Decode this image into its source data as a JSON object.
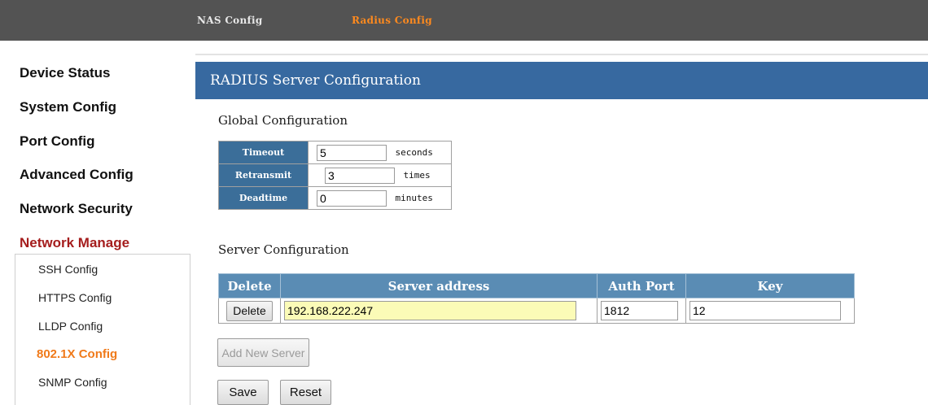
{
  "topbar": {
    "tabs": [
      {
        "label": "NAS Config",
        "active": false
      },
      {
        "label": "Radius Config",
        "active": true
      }
    ],
    "active_color": "#ff8a1e"
  },
  "sidebar": {
    "items": [
      {
        "label": "Device Status"
      },
      {
        "label": "System Config"
      },
      {
        "label": "Port Config"
      },
      {
        "label": "Advanced Config"
      },
      {
        "label": "Network Security"
      },
      {
        "label": "Network Manage",
        "active": true
      }
    ],
    "subitems": [
      {
        "label": "SSH Config"
      },
      {
        "label": "HTTPS Config"
      },
      {
        "label": "LLDP Config"
      },
      {
        "label": "802.1X Config",
        "active": true
      },
      {
        "label": "SNMP Config"
      }
    ]
  },
  "main": {
    "title": "RADIUS Server Configuration",
    "global": {
      "heading": "Global Configuration",
      "rows": [
        {
          "label": "Timeout",
          "value": "5",
          "unit": "seconds"
        },
        {
          "label": "Retransmit",
          "value": "3",
          "unit": "times"
        },
        {
          "label": "Deadtime",
          "value": "0",
          "unit": "minutes"
        }
      ]
    },
    "server": {
      "heading": "Server Configuration",
      "columns": [
        "Delete",
        "Server address",
        "Auth Port",
        "Key"
      ],
      "rows": [
        {
          "delete_label": "Delete",
          "address": "192.168.222.247",
          "auth_port": "1812",
          "key": "12"
        }
      ]
    },
    "buttons": {
      "add": "Add New Server",
      "save": "Save",
      "reset": "Reset"
    }
  },
  "colors": {
    "title_bar": "#3769a0",
    "header_cell": "#5a8cb4",
    "label_cell": "#3b6e99",
    "active_menu": "#a51d1d",
    "active_submenu": "#f07a1a",
    "address_field": "#fbfbb7"
  }
}
